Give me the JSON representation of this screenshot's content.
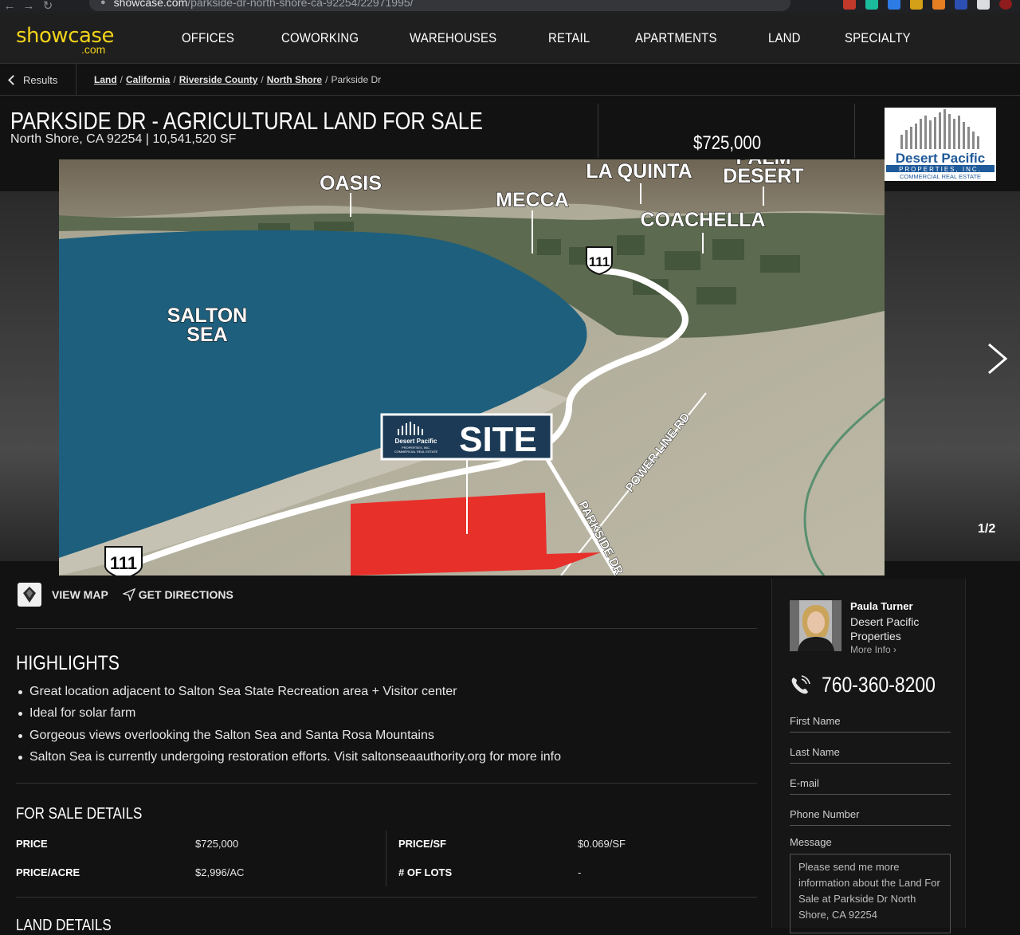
{
  "browser": {
    "url_host": "showcase.com",
    "url_path": "/parkside-dr-north-shore-ca-92254/22971995/"
  },
  "header": {
    "logo_main": "showcase",
    "logo_sub": ".com",
    "nav": [
      "OFFICES",
      "COWORKING",
      "WAREHOUSES",
      "RETAIL",
      "APARTMENTS",
      "LAND",
      "SPECIALTY"
    ]
  },
  "breadcrumb": {
    "back_label": "Results",
    "items": [
      "Land",
      "California",
      "Riverside County",
      "North Shore"
    ],
    "current": "Parkside Dr"
  },
  "listing": {
    "title": "PARKSIDE DR - AGRICULTURAL LAND FOR SALE",
    "subtitle": "North Shore, CA 92254 | 10,541,520 SF",
    "price": "$725,000"
  },
  "broker_logo": {
    "line1": "Desert Pacific",
    "line2": "PROPERTIES, INC.",
    "line3": "COMMERCIAL REAL ESTATE"
  },
  "gallery": {
    "counter": "1/2",
    "map_labels": {
      "oasis": "OASIS",
      "la_quinta": "LA QUINTA",
      "palm": "PALM",
      "desert": "DESERT",
      "mecca": "MECCA",
      "coachella": "COACHELLA",
      "salton": "SALTON",
      "sea": "SEA",
      "site": "SITE",
      "site_logo_1": "Desert Pacific",
      "site_logo_2": "PROPERTIES, INC.",
      "site_logo_3": "COMMERCIAL REAL ESTATE",
      "route_a": "111",
      "route_b": "111",
      "power_line": "POWER LINE RD",
      "parkside": "PARKSIDE DR"
    }
  },
  "map_actions": {
    "view_map": "VIEW MAP",
    "get_directions": "GET DIRECTIONS"
  },
  "highlights": {
    "title": "HIGHLIGHTS",
    "items": [
      "Great location adjacent to Salton Sea State Recreation area + Visitor center",
      "Ideal for solar farm",
      "Gorgeous views overlooking the Salton Sea and Santa Rosa Mountains",
      "Salton Sea is currently undergoing restoration efforts. Visit saltonseaauthority.org for more info"
    ]
  },
  "sale_details": {
    "title": "FOR SALE DETAILS",
    "rows": [
      {
        "label": "PRICE",
        "value": "$725,000"
      },
      {
        "label": "PRICE/SF",
        "value": "$0.069/SF"
      },
      {
        "label": "PRICE/ACRE",
        "value": "$2,996/AC"
      },
      {
        "label": "# OF LOTS",
        "value": "-"
      }
    ]
  },
  "land_details": {
    "title": "LAND DETAILS"
  },
  "contact": {
    "agent_name": "Paula Turner",
    "agent_company": "Desert Pacific Properties",
    "more_info": "More Info",
    "phone": "760-360-8200",
    "fields": [
      "First Name",
      "Last Name",
      "E-mail",
      "Phone Number"
    ],
    "message_label": "Message",
    "message_text": "Please send me more information about the Land For Sale at Parkside Dr North Shore, CA 92254"
  },
  "colors": {
    "brand_yellow": "#f2d21b",
    "site_red": "#e8302b",
    "sea_blue": "#1d5f7d",
    "logo_blue": "#1f5a9a"
  }
}
